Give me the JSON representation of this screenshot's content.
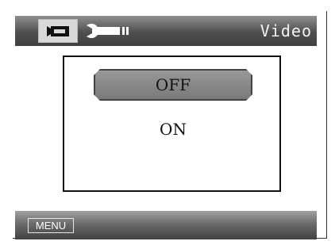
{
  "header": {
    "title": "Video",
    "tabs": [
      {
        "icon": "video-camera-icon",
        "active": true
      },
      {
        "icon": "wrench-settings-icon",
        "active": false
      }
    ]
  },
  "dialog": {
    "options": [
      "OFF",
      "ON"
    ],
    "selected": "OFF"
  },
  "footer": {
    "menu_label": "MENU"
  },
  "colors": {
    "bar_dark": "#404040",
    "bar_light": "#a0a0a0",
    "selected_option": "#888888",
    "active_tab": "#d9d9d9"
  }
}
